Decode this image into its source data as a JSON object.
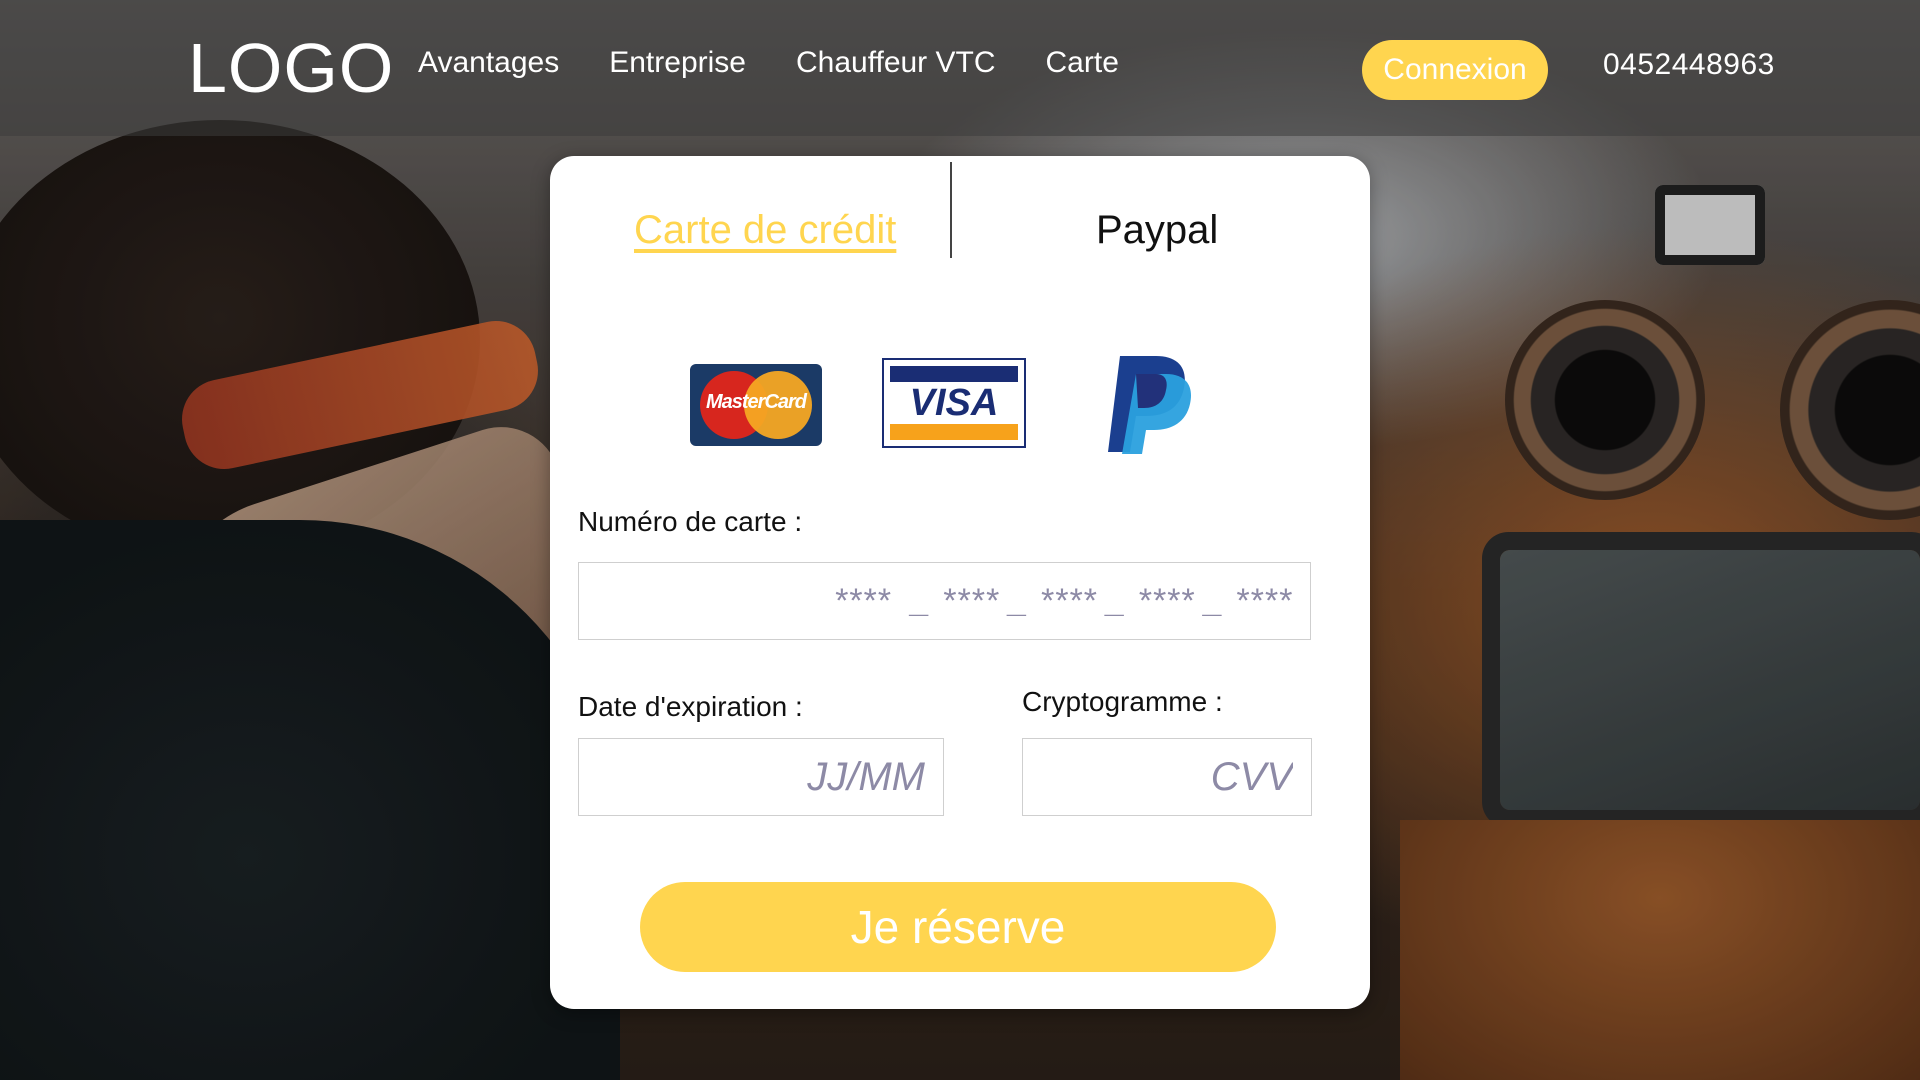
{
  "nav": {
    "logo": "LOGO",
    "links": [
      "Avantages",
      "Entreprise",
      "Chauffeur VTC",
      "Carte"
    ],
    "login_label": "Connexion",
    "phone": "0452448963"
  },
  "payment": {
    "tabs": {
      "credit": "Carte de crédit",
      "paypal": "Paypal"
    },
    "brands": {
      "mastercard": "MasterCard",
      "visa": "VISA"
    },
    "card_number": {
      "label": "Numéro de carte :",
      "placeholder": "****  _ **** _ **** _ **** _ ****"
    },
    "expiry": {
      "label": "Date d'expiration :",
      "placeholder": "JJ/MM"
    },
    "cvv": {
      "label": "Cryptogramme :",
      "placeholder": "CVV"
    },
    "submit_label": "Je réserve"
  },
  "colors": {
    "accent": "#ffd54f",
    "text": "#111111",
    "placeholder": "#8d8aa6"
  }
}
